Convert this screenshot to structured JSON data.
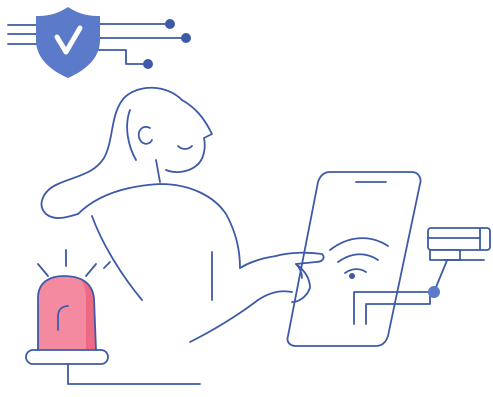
{
  "colors": {
    "line": "#3d5aa8",
    "accent_blue": "#5b7ac9",
    "check": "#ffffff",
    "siren_fill": "#f48aa0",
    "siren_shade": "#ec6a83",
    "background": "#ffffff"
  },
  "icons": {
    "shield": "shield-check-icon",
    "wifi": "wifi-icon",
    "camera": "security-camera-icon",
    "siren": "alarm-siren-icon"
  }
}
